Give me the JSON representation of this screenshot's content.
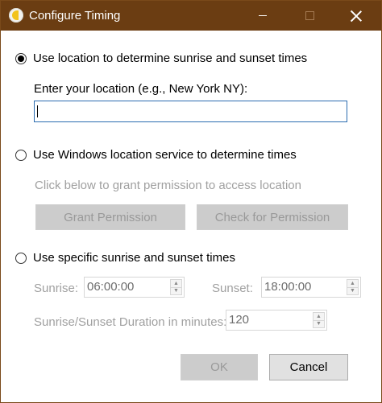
{
  "window": {
    "title": "Configure Timing",
    "minimize_icon": "minimize-icon",
    "maximize_icon": "maximize-icon",
    "close_icon": "close-icon"
  },
  "options": {
    "location": {
      "label": "Use location to determine sunrise and sunset times",
      "selected": true,
      "field_label": "Enter your location (e.g., New York NY):",
      "field_value": ""
    },
    "windows_location": {
      "label": "Use Windows location service to determine times",
      "selected": false,
      "hint": "Click below to grant permission to access location",
      "grant_button": "Grant Permission",
      "check_button": "Check for Permission"
    },
    "specific": {
      "label": "Use specific sunrise and sunset times",
      "selected": false,
      "sunrise_label": "Sunrise:",
      "sunrise_value": "06:00:00",
      "sunset_label": "Sunset:",
      "sunset_value": "18:00:00",
      "duration_label": "Sunrise/Sunset Duration in minutes:",
      "duration_value": "120"
    }
  },
  "footer": {
    "ok_label": "OK",
    "cancel_label": "Cancel"
  },
  "colors": {
    "titlebar": "#6b3d12",
    "focus_border": "#2b6cb0",
    "disabled_text": "#a0a0a0"
  }
}
